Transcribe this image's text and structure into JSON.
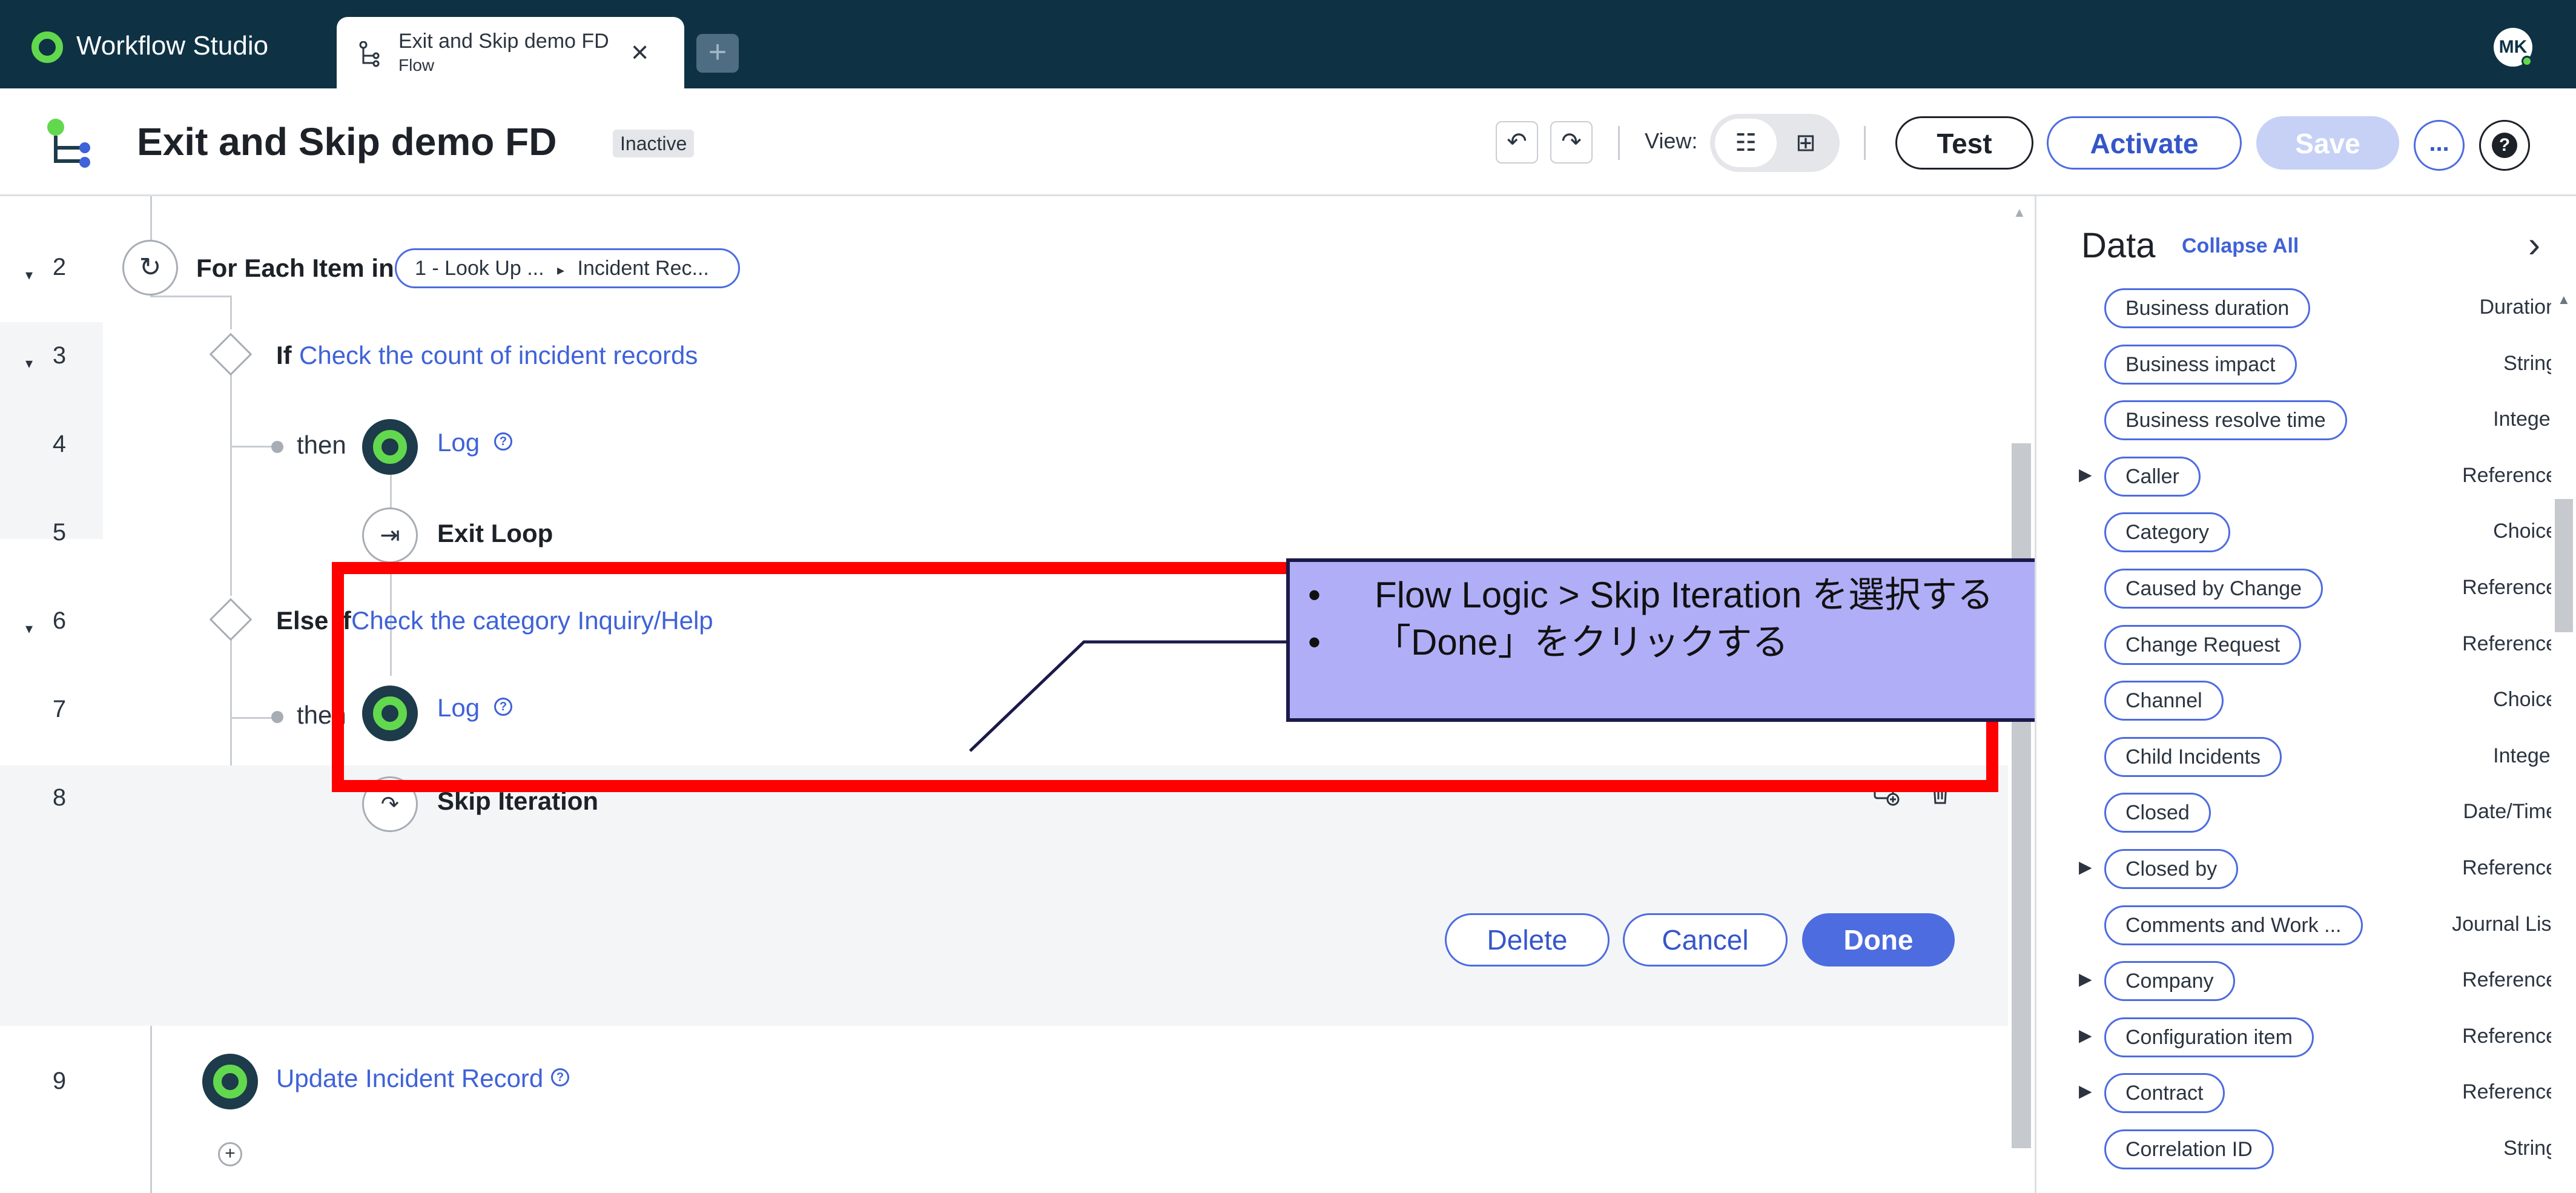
{
  "app": {
    "brand": "Workflow Studio",
    "tab": {
      "title": "Exit and Skip demo FD",
      "subtitle": "Flow"
    },
    "new_tab": "+",
    "user_initials": "MK"
  },
  "header": {
    "title": "Exit and Skip demo FD",
    "status": "Inactive",
    "view_label": "View:",
    "test": "Test",
    "activate": "Activate",
    "save": "Save",
    "more": "...",
    "help": "?"
  },
  "flow": {
    "rows": [
      {
        "num": "2",
        "keyword": "For Each Item in",
        "pills": [
          "1 - Look Up ...",
          "Incident Rec..."
        ]
      },
      {
        "num": "3",
        "keyword": "If",
        "link": "Check the count of incident records"
      },
      {
        "num": "4",
        "prefix": "then",
        "link": "Log"
      },
      {
        "num": "5",
        "keyword": "Exit Loop"
      },
      {
        "num": "6",
        "keyword": "Else If",
        "link": "Check the category Inquiry/Help"
      },
      {
        "num": "7",
        "prefix": "then",
        "link": "Log"
      },
      {
        "num": "8",
        "keyword": "Skip Iteration"
      },
      {
        "num": "9",
        "link": "Update Incident Record"
      }
    ],
    "card_buttons": {
      "delete": "Delete",
      "cancel": "Cancel",
      "done": "Done"
    }
  },
  "callout": {
    "bullet": "•",
    "lines": [
      "Flow Logic > Skip Iteration を選択する",
      "「Done」をクリックする"
    ]
  },
  "data_panel": {
    "title": "Data",
    "collapse_all": "Collapse All",
    "fields": [
      {
        "label": "Business duration",
        "type": "Duration",
        "expandable": false
      },
      {
        "label": "Business impact",
        "type": "String",
        "expandable": false
      },
      {
        "label": "Business resolve time",
        "type": "Integer",
        "expandable": false
      },
      {
        "label": "Caller",
        "type": "Reference",
        "expandable": true
      },
      {
        "label": "Category",
        "type": "Choice",
        "expandable": false
      },
      {
        "label": "Caused by Change",
        "type": "Reference",
        "expandable": false
      },
      {
        "label": "Change Request",
        "type": "Reference",
        "expandable": false
      },
      {
        "label": "Channel",
        "type": "Choice",
        "expandable": false
      },
      {
        "label": "Child Incidents",
        "type": "Integer",
        "expandable": false
      },
      {
        "label": "Closed",
        "type": "Date/Time",
        "expandable": false
      },
      {
        "label": "Closed by",
        "type": "Reference",
        "expandable": true
      },
      {
        "label": "Comments and Work ...",
        "type": "Journal List",
        "expandable": false
      },
      {
        "label": "Company",
        "type": "Reference",
        "expandable": true
      },
      {
        "label": "Configuration item",
        "type": "Reference",
        "expandable": true
      },
      {
        "label": "Contract",
        "type": "Reference",
        "expandable": true
      },
      {
        "label": "Correlation ID",
        "type": "String",
        "expandable": false
      }
    ]
  },
  "colors": {
    "appbar": "#0e3244",
    "accent": "#4d6ce0",
    "link": "#3f62d8",
    "brand_green": "#62d84e",
    "highlight": "#ff0000",
    "callout_bg": "#b1aef8"
  },
  "icons": [
    "workflow-logo-icon",
    "flow-tab-icon",
    "close-icon",
    "undo-icon",
    "redo-icon",
    "list-view-icon",
    "diagram-view-icon",
    "more-icon",
    "help-icon",
    "for-each-icon",
    "condition-icon",
    "exit-loop-icon",
    "skip-iteration-icon",
    "action-icon",
    "add-step-icon",
    "add-comment-icon",
    "trash-icon",
    "chevron-right-icon"
  ]
}
